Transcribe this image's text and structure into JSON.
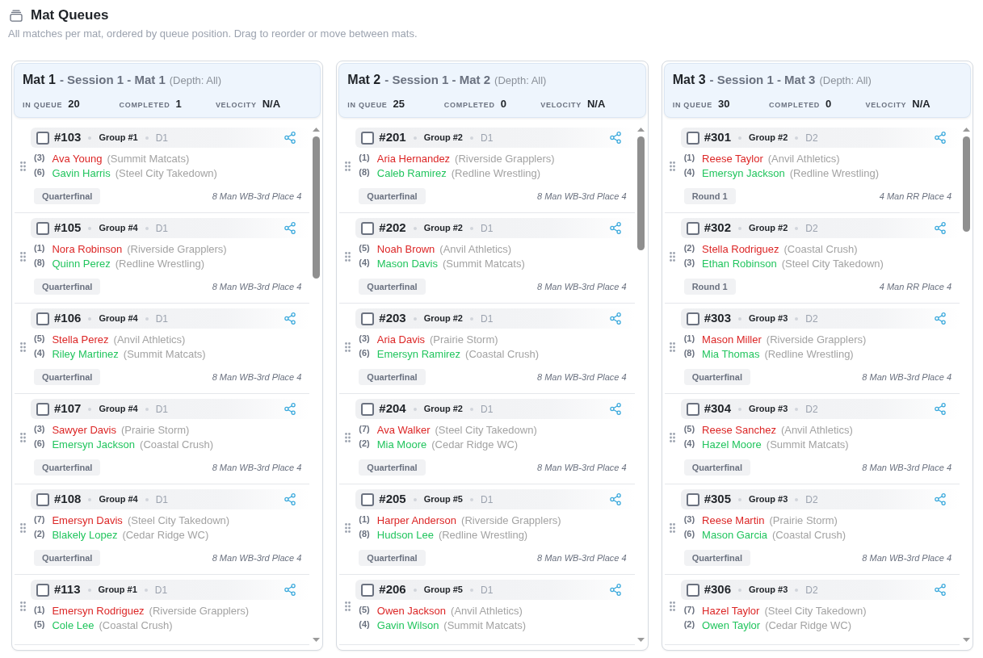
{
  "page": {
    "title": "Mat Queues",
    "subtitle": "All matches per mat, ordered by queue position. Drag to reorder or move between mats."
  },
  "mats": [
    {
      "name": "Mat 1",
      "session": "- Session 1 - Mat 1",
      "depth": "(Depth: All)",
      "stats": [
        {
          "label": "IN QUEUE",
          "value": "20"
        },
        {
          "label": "COMPLETED",
          "value": "1"
        },
        {
          "label": "VELOCITY",
          "value": "N/A"
        }
      ],
      "matches": [
        {
          "number": "#103",
          "checked": false,
          "group": "Group #1",
          "division": "D1",
          "wrestlers": [
            {
              "seed": "(3)",
              "name": "Ava Young",
              "team": "(Summit Matcats)",
              "color": "#dc2626"
            },
            {
              "seed": "(6)",
              "name": "Gavin Harris",
              "team": "(Steel City Takedown)",
              "color": "#22c55e"
            }
          ],
          "round": "Quarterfinal",
          "bracket": "8 Man WB-3rd Place 4"
        },
        {
          "number": "#105",
          "checked": false,
          "group": "Group #4",
          "division": "D1",
          "wrestlers": [
            {
              "seed": "(1)",
              "name": "Nora Robinson",
              "team": "(Riverside Grapplers)",
              "color": "#dc2626"
            },
            {
              "seed": "(8)",
              "name": "Quinn Perez",
              "team": "(Redline Wrestling)",
              "color": "#22c55e"
            }
          ],
          "round": "Quarterfinal",
          "bracket": "8 Man WB-3rd Place 4"
        },
        {
          "number": "#106",
          "checked": false,
          "group": "Group #4",
          "division": "D1",
          "wrestlers": [
            {
              "seed": "(5)",
              "name": "Stella Perez",
              "team": "(Anvil Athletics)",
              "color": "#dc2626"
            },
            {
              "seed": "(4)",
              "name": "Riley Martinez",
              "team": "(Summit Matcats)",
              "color": "#22c55e"
            }
          ],
          "round": "Quarterfinal",
          "bracket": "8 Man WB-3rd Place 4"
        },
        {
          "number": "#107",
          "checked": false,
          "group": "Group #4",
          "division": "D1",
          "wrestlers": [
            {
              "seed": "(3)",
              "name": "Sawyer Davis",
              "team": "(Prairie Storm)",
              "color": "#dc2626"
            },
            {
              "seed": "(6)",
              "name": "Emersyn Jackson",
              "team": "(Coastal Crush)",
              "color": "#22c55e"
            }
          ],
          "round": "Quarterfinal",
          "bracket": "8 Man WB-3rd Place 4"
        },
        {
          "number": "#108",
          "checked": false,
          "group": "Group #4",
          "division": "D1",
          "wrestlers": [
            {
              "seed": "(7)",
              "name": "Emersyn Davis",
              "team": "(Steel City Takedown)",
              "color": "#dc2626"
            },
            {
              "seed": "(2)",
              "name": "Blakely Lopez",
              "team": "(Cedar Ridge WC)",
              "color": "#22c55e"
            }
          ],
          "round": "Quarterfinal",
          "bracket": "8 Man WB-3rd Place 4"
        },
        {
          "number": "#113",
          "checked": false,
          "group": "Group #1",
          "division": "D1",
          "wrestlers": [
            {
              "seed": "(1)",
              "name": "Emersyn Rodriguez",
              "team": "(Riverside Grapplers)",
              "color": "#dc2626"
            },
            {
              "seed": "(5)",
              "name": "Cole Lee",
              "team": "(Coastal Crush)",
              "color": "#22c55e"
            }
          ]
        }
      ]
    },
    {
      "name": "Mat 2",
      "session": "- Session 1 - Mat 2",
      "depth": "(Depth: All)",
      "stats": [
        {
          "label": "IN QUEUE",
          "value": "25"
        },
        {
          "label": "COMPLETED",
          "value": "0"
        },
        {
          "label": "VELOCITY",
          "value": "N/A"
        }
      ],
      "matches": [
        {
          "number": "#201",
          "checked": false,
          "group": "Group #2",
          "division": "D1",
          "wrestlers": [
            {
              "seed": "(1)",
              "name": "Aria Hernandez",
              "team": "(Riverside Grapplers)",
              "color": "#dc2626"
            },
            {
              "seed": "(8)",
              "name": "Caleb Ramirez",
              "team": "(Redline Wrestling)",
              "color": "#22c55e"
            }
          ],
          "round": "Quarterfinal",
          "bracket": "8 Man WB-3rd Place 4"
        },
        {
          "number": "#202",
          "checked": false,
          "group": "Group #2",
          "division": "D1",
          "wrestlers": [
            {
              "seed": "(5)",
              "name": "Noah Brown",
              "team": "(Anvil Athletics)",
              "color": "#dc2626"
            },
            {
              "seed": "(4)",
              "name": "Mason Davis",
              "team": "(Summit Matcats)",
              "color": "#22c55e"
            }
          ],
          "round": "Quarterfinal",
          "bracket": "8 Man WB-3rd Place 4"
        },
        {
          "number": "#203",
          "checked": false,
          "group": "Group #2",
          "division": "D1",
          "wrestlers": [
            {
              "seed": "(3)",
              "name": "Aria Davis",
              "team": "(Prairie Storm)",
              "color": "#dc2626"
            },
            {
              "seed": "(6)",
              "name": "Emersyn Ramirez",
              "team": "(Coastal Crush)",
              "color": "#22c55e"
            }
          ],
          "round": "Quarterfinal",
          "bracket": "8 Man WB-3rd Place 4"
        },
        {
          "number": "#204",
          "checked": false,
          "group": "Group #2",
          "division": "D1",
          "wrestlers": [
            {
              "seed": "(7)",
              "name": "Ava Walker",
              "team": "(Steel City Takedown)",
              "color": "#dc2626"
            },
            {
              "seed": "(2)",
              "name": "Mia Moore",
              "team": "(Cedar Ridge WC)",
              "color": "#22c55e"
            }
          ],
          "round": "Quarterfinal",
          "bracket": "8 Man WB-3rd Place 4"
        },
        {
          "number": "#205",
          "checked": false,
          "group": "Group #5",
          "division": "D1",
          "wrestlers": [
            {
              "seed": "(1)",
              "name": "Harper Anderson",
              "team": "(Riverside Grapplers)",
              "color": "#dc2626"
            },
            {
              "seed": "(8)",
              "name": "Hudson Lee",
              "team": "(Redline Wrestling)",
              "color": "#22c55e"
            }
          ],
          "round": "Quarterfinal",
          "bracket": "8 Man WB-3rd Place 4"
        },
        {
          "number": "#206",
          "checked": false,
          "group": "Group #5",
          "division": "D1",
          "wrestlers": [
            {
              "seed": "(5)",
              "name": "Owen Jackson",
              "team": "(Anvil Athletics)",
              "color": "#dc2626"
            },
            {
              "seed": "(4)",
              "name": "Gavin Wilson",
              "team": "(Summit Matcats)",
              "color": "#22c55e"
            }
          ]
        }
      ]
    },
    {
      "name": "Mat 3",
      "session": "- Session 1 - Mat 3",
      "depth": "(Depth: All)",
      "stats": [
        {
          "label": "IN QUEUE",
          "value": "30"
        },
        {
          "label": "COMPLETED",
          "value": "0"
        },
        {
          "label": "VELOCITY",
          "value": "N/A"
        }
      ],
      "matches": [
        {
          "number": "#301",
          "checked": false,
          "group": "Group #2",
          "division": "D2",
          "wrestlers": [
            {
              "seed": "(1)",
              "name": "Reese Taylor",
              "team": "(Anvil Athletics)",
              "color": "#dc2626"
            },
            {
              "seed": "(4)",
              "name": "Emersyn Jackson",
              "team": "(Redline Wrestling)",
              "color": "#22c55e"
            }
          ],
          "round": "Round 1",
          "bracket": "4 Man RR Place 4"
        },
        {
          "number": "#302",
          "checked": false,
          "group": "Group #2",
          "division": "D2",
          "wrestlers": [
            {
              "seed": "(2)",
              "name": "Stella Rodriguez",
              "team": "(Coastal Crush)",
              "color": "#dc2626"
            },
            {
              "seed": "(3)",
              "name": "Ethan Robinson",
              "team": "(Steel City Takedown)",
              "color": "#22c55e"
            }
          ],
          "round": "Round 1",
          "bracket": "4 Man RR Place 4"
        },
        {
          "number": "#303",
          "checked": false,
          "group": "Group #3",
          "division": "D2",
          "wrestlers": [
            {
              "seed": "(1)",
              "name": "Mason Miller",
              "team": "(Riverside Grapplers)",
              "color": "#dc2626"
            },
            {
              "seed": "(8)",
              "name": "Mia Thomas",
              "team": "(Redline Wrestling)",
              "color": "#22c55e"
            }
          ],
          "round": "Quarterfinal",
          "bracket": "8 Man WB-3rd Place 4"
        },
        {
          "number": "#304",
          "checked": false,
          "group": "Group #3",
          "division": "D2",
          "wrestlers": [
            {
              "seed": "(5)",
              "name": "Reese Sanchez",
              "team": "(Anvil Athletics)",
              "color": "#dc2626"
            },
            {
              "seed": "(4)",
              "name": "Hazel Moore",
              "team": "(Summit Matcats)",
              "color": "#22c55e"
            }
          ],
          "round": "Quarterfinal",
          "bracket": "8 Man WB-3rd Place 4"
        },
        {
          "number": "#305",
          "checked": false,
          "group": "Group #3",
          "division": "D2",
          "wrestlers": [
            {
              "seed": "(3)",
              "name": "Reese Martin",
              "team": "(Prairie Storm)",
              "color": "#dc2626"
            },
            {
              "seed": "(6)",
              "name": "Mason Garcia",
              "team": "(Coastal Crush)",
              "color": "#22c55e"
            }
          ],
          "round": "Quarterfinal",
          "bracket": "8 Man WB-3rd Place 4"
        },
        {
          "number": "#306",
          "checked": false,
          "group": "Group #3",
          "division": "D2",
          "wrestlers": [
            {
              "seed": "(7)",
              "name": "Hazel Taylor",
              "team": "(Steel City Takedown)",
              "color": "#dc2626"
            },
            {
              "seed": "(2)",
              "name": "Owen Taylor",
              "team": "(Cedar Ridge WC)",
              "color": "#22c55e"
            }
          ]
        }
      ]
    }
  ]
}
